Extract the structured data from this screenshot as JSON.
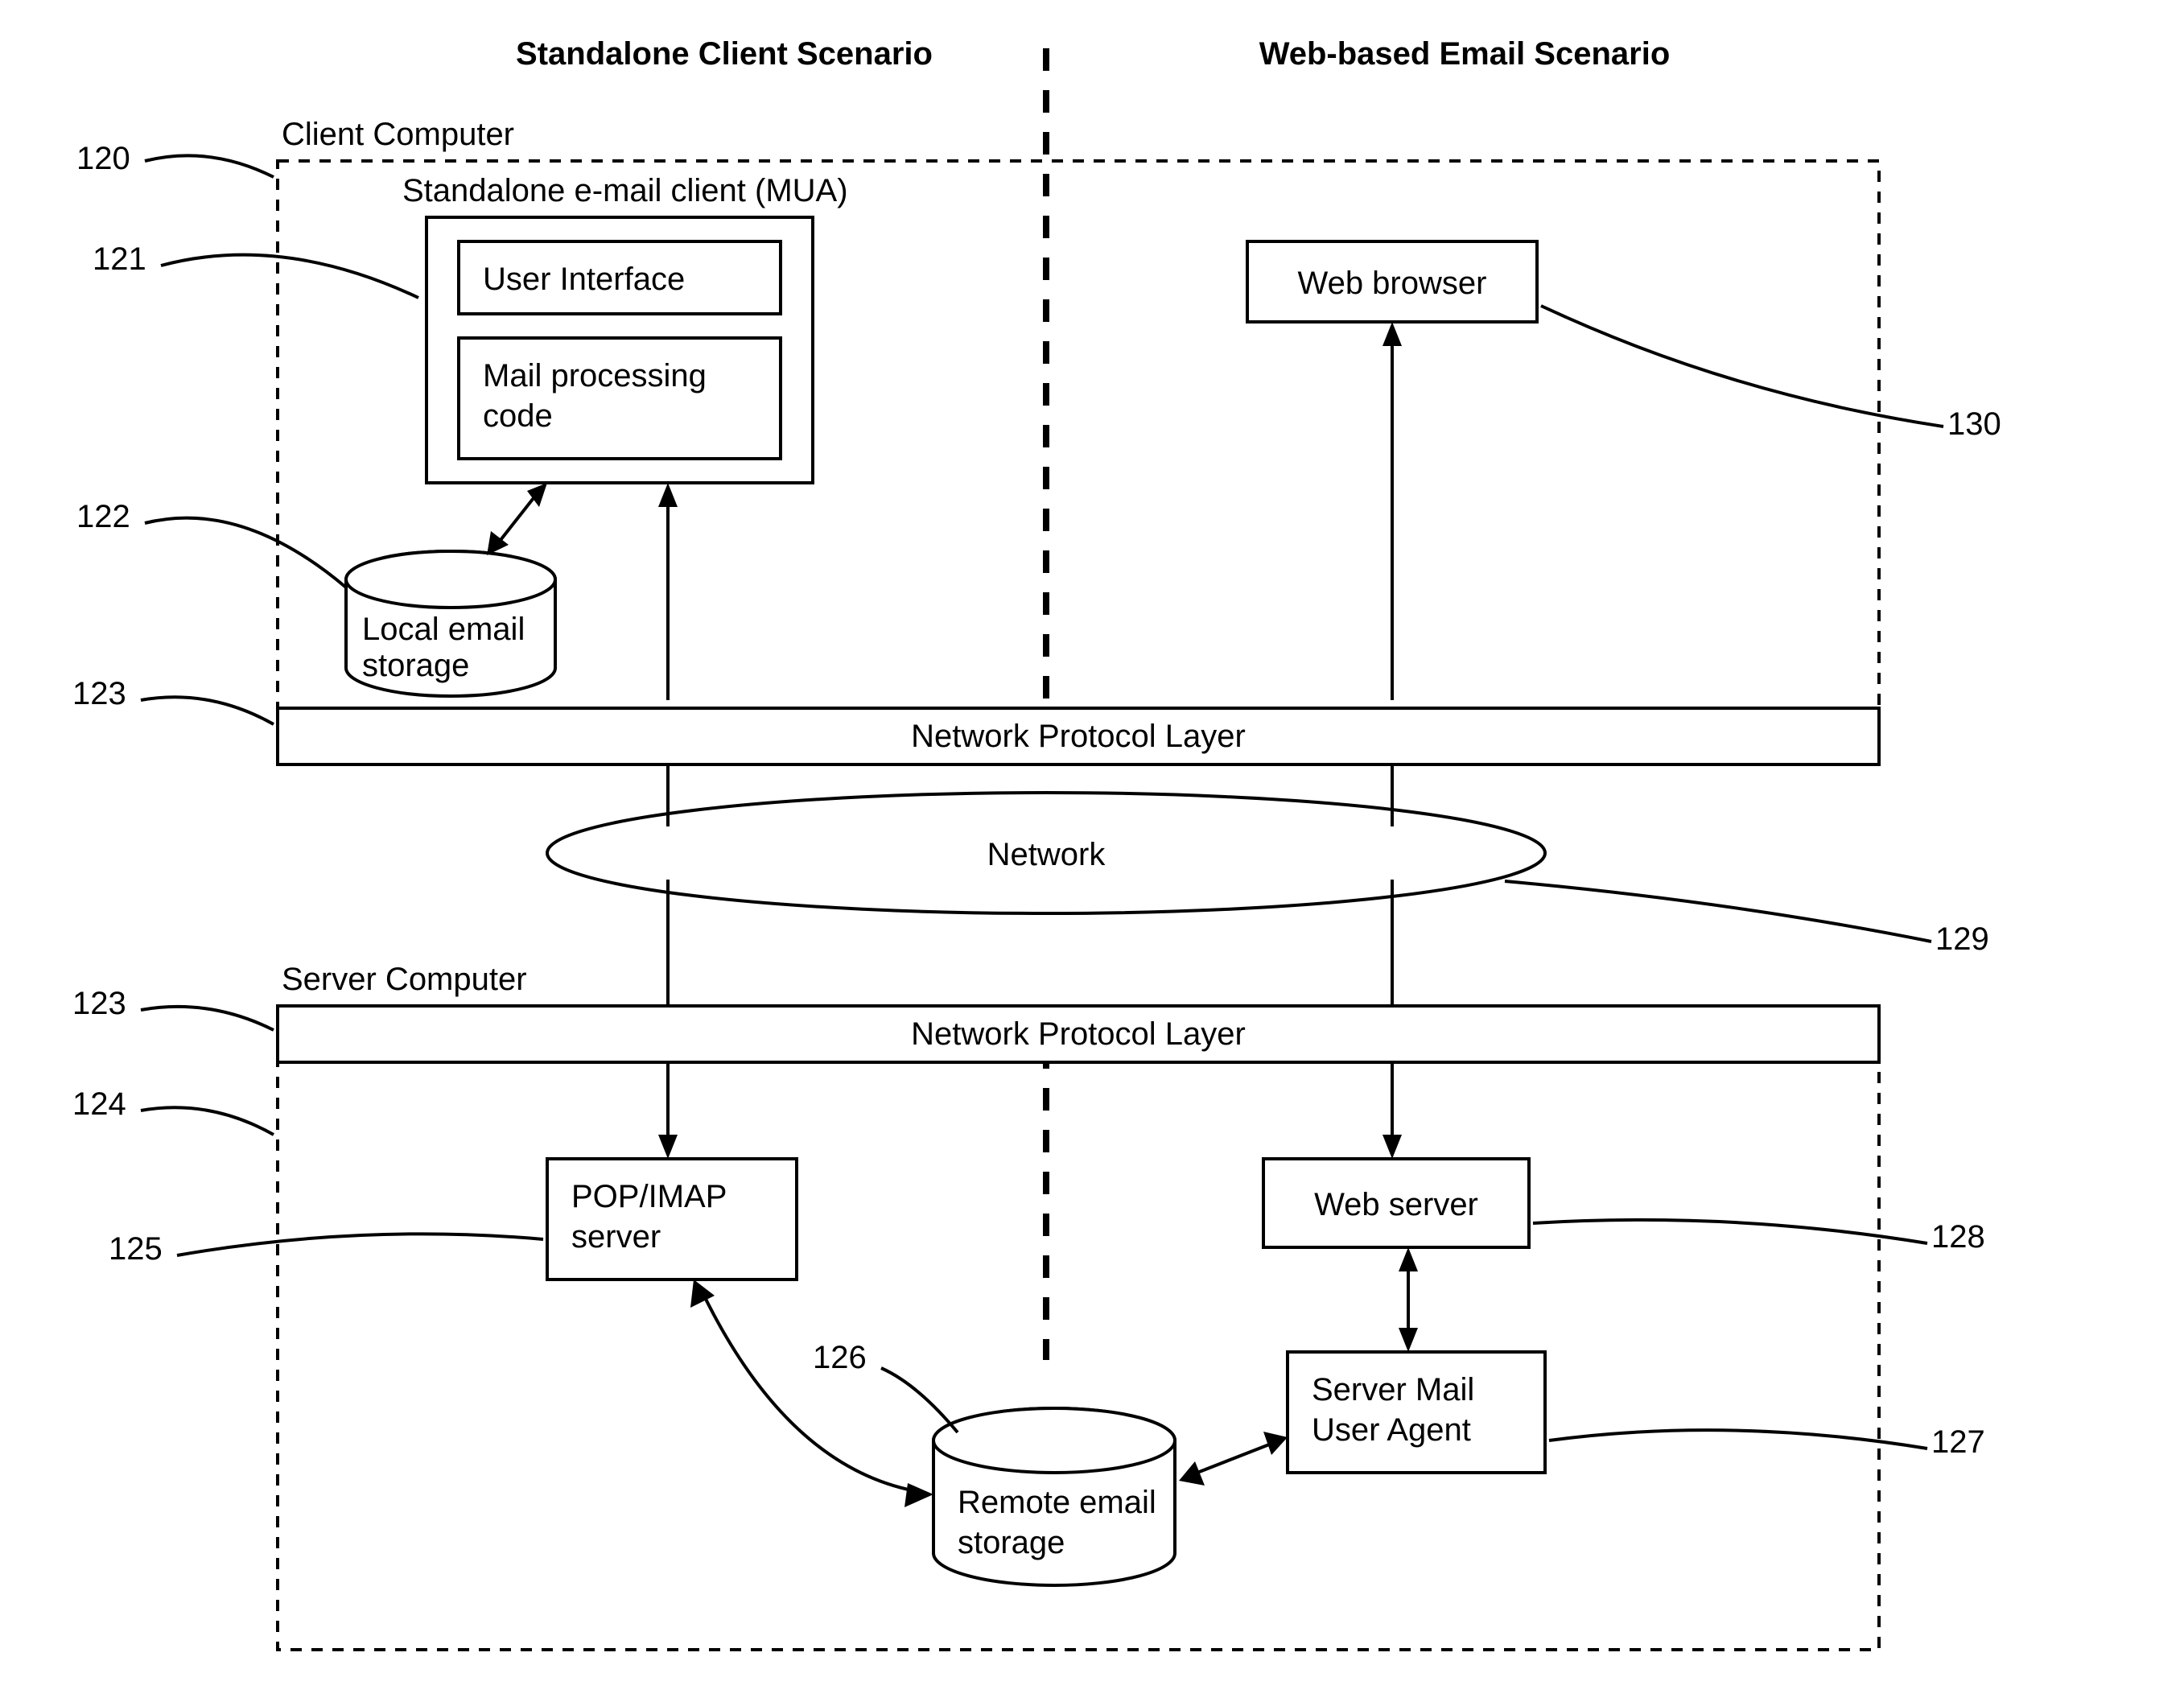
{
  "headings": {
    "standalone": "Standalone Client Scenario",
    "webbased": "Web-based Email Scenario",
    "client": "Client Computer",
    "server": "Server Computer"
  },
  "boxes": {
    "mua_title": "Standalone e-mail client (MUA)",
    "ui": "User Interface",
    "mailproc_l1": "Mail processing",
    "mailproc_l2": "code",
    "browser": "Web browser",
    "npl_client": "Network Protocol Layer",
    "network": "Network",
    "npl_server": "Network Protocol Layer",
    "pop_l1": "POP/IMAP",
    "pop_l2": "server",
    "webserver": "Web server",
    "smua_l1": "Server Mail",
    "smua_l2": "User Agent"
  },
  "cylinders": {
    "local_l1": "Local email",
    "local_l2": "storage",
    "remote_l1": "Remote email",
    "remote_l2": "storage"
  },
  "refs": {
    "r120": "120",
    "r121": "121",
    "r122": "122",
    "r123a": "123",
    "r123b": "123",
    "r124": "124",
    "r125": "125",
    "r126": "126",
    "r127": "127",
    "r128": "128",
    "r129": "129",
    "r130": "130"
  }
}
